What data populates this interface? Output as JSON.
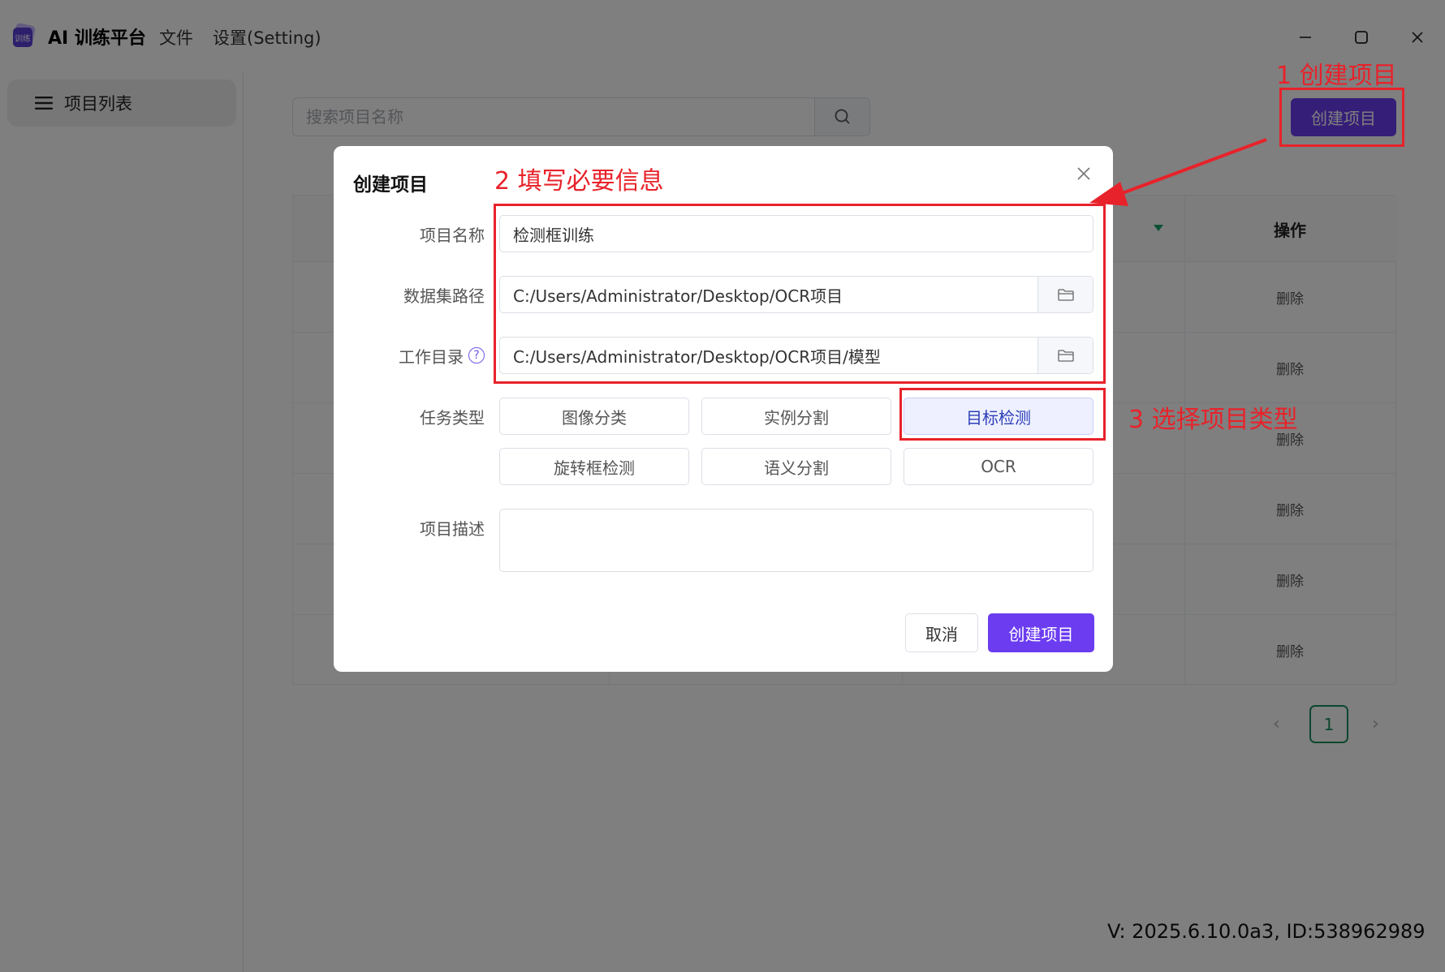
{
  "app": {
    "name": "AI 训练平台",
    "menu": [
      "文件",
      "设置(Setting)"
    ]
  },
  "sidebar": {
    "items": [
      {
        "label": "项目列表",
        "icon": "hamburger-menu-icon"
      }
    ]
  },
  "main": {
    "search_placeholder": "搜索项目名称",
    "create_button": "创建项目",
    "table": {
      "ops_header": "操作",
      "rows": [
        {
          "action": "删除"
        },
        {
          "action": "删除"
        },
        {
          "action": "删除"
        },
        {
          "action": "删除"
        },
        {
          "action": "删除"
        },
        {
          "action": "删除"
        }
      ]
    },
    "pagination": {
      "current": "1"
    }
  },
  "version": "V: 2025.6.10.0a3, ID:538962989",
  "dialog": {
    "title": "创建项目",
    "fields": {
      "name_label": "项目名称",
      "name_value": "检测框训练",
      "dataset_label": "数据集路径",
      "dataset_value": "C:/Users/Administrator/Desktop/OCR项目",
      "workdir_label": "工作目录",
      "workdir_value": "C:/Users/Administrator/Desktop/OCR项目/模型",
      "task_label": "任务类型",
      "desc_label": "项目描述",
      "desc_value": ""
    },
    "task_types": [
      "图像分类",
      "实例分割",
      "目标检测",
      "旋转框检测",
      "语义分割",
      "OCR"
    ],
    "selected_task": "目标检测",
    "cancel": "取消",
    "confirm": "创建项目"
  },
  "annotations": {
    "step1": "1 创建项目",
    "step2": "2 填写必要信息",
    "step3": "3 选择项目类型",
    "color": "#e8222a"
  },
  "colors": {
    "primary": "#6b3cf0",
    "page_active": "#1a8f5e",
    "selected_bg": "#eef0ff"
  }
}
